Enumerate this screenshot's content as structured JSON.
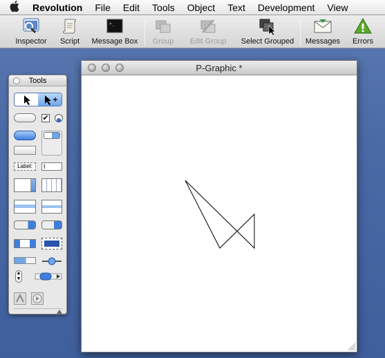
{
  "menubar": {
    "app": "Revolution",
    "items": [
      "File",
      "Edit",
      "Tools",
      "Object",
      "Text",
      "Development",
      "View"
    ]
  },
  "toolbar": {
    "buttons": [
      {
        "label": "Inspector",
        "enabled": true,
        "icon": "inspector-icon"
      },
      {
        "label": "Script",
        "enabled": true,
        "icon": "script-scroll-icon"
      },
      {
        "label": "Message Box",
        "enabled": true,
        "icon": "message-box-icon"
      },
      {
        "label": "Group",
        "enabled": false,
        "icon": "group-icon"
      },
      {
        "label": "Edit Group",
        "enabled": false,
        "icon": "edit-group-icon"
      },
      {
        "label": "Select Grouped",
        "enabled": true,
        "icon": "select-grouped-icon"
      },
      {
        "label": "Messages",
        "enabled": true,
        "icon": "messages-envelope-icon"
      },
      {
        "label": "Errors",
        "enabled": true,
        "icon": "errors-warning-icon"
      }
    ]
  },
  "tools_palette": {
    "title": "Tools",
    "label_tool_text": "Label:",
    "tools": [
      "browse-tool",
      "pointer-tool",
      "push-button-tool",
      "checkbox-tool",
      "radio-button-tool",
      "default-button-tool",
      "tab-panel-tool",
      "rectangle-button-tool",
      "group-box-tool",
      "label-field-tool",
      "text-field-tool",
      "scrolling-field-tool",
      "table-field-tool",
      "scrolling-list-tool",
      "list-field-tool",
      "popup-menu-tool",
      "combo-box-tool",
      "option-menu-tool",
      "image-tool",
      "progress-bar-tool",
      "slider-tool",
      "little-arrows-tool",
      "scrollbar-tool",
      "graphic-tool",
      "player-tool"
    ]
  },
  "document": {
    "title": "P-Graphic *"
  },
  "colors": {
    "desktop": "#4a6aa6",
    "selection_blue": "#3f7fdc"
  }
}
